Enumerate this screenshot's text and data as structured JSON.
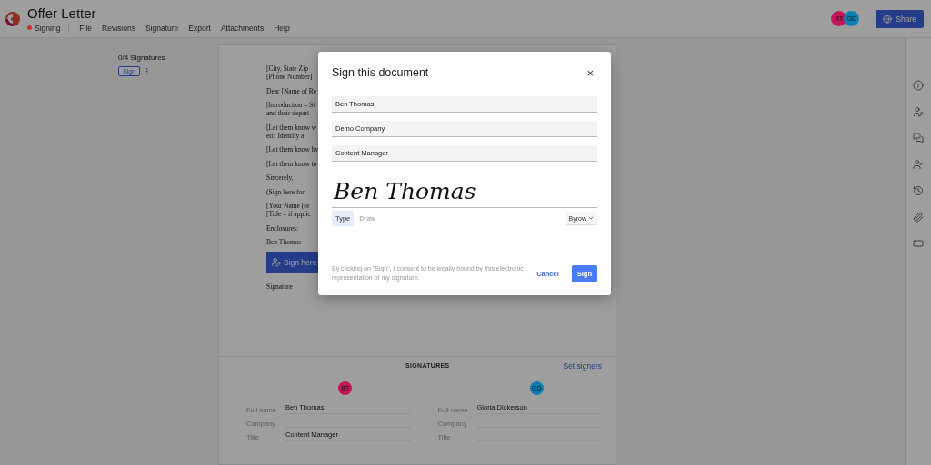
{
  "header": {
    "title": "Offer Letter",
    "status": {
      "label": "Signing",
      "color": "#c0392b"
    },
    "menu": [
      "File",
      "Revisions",
      "Signature",
      "Export",
      "Attachments",
      "Help"
    ],
    "avatars": [
      {
        "initials": "BT",
        "color": "#c2185b"
      },
      {
        "initials": "GD",
        "color": "#0a7fb0"
      }
    ],
    "share": "Share"
  },
  "signature_panel": {
    "count": "0/4 Signatures",
    "sign_button": "Sign"
  },
  "document": {
    "paragraphs": [
      [
        "[City, State Zip",
        "[Phone Number]"
      ],
      [
        "Dear [Name of Re"
      ],
      [
        "[Introduction – St",
        "and their depart"
      ],
      [
        "[Let them know w",
        "etc. Identify a"
      ],
      [
        "[Let them know by"
      ],
      [
        "[Let them know to"
      ],
      [
        "Sincerely,"
      ],
      [
        "(Sign here for"
      ],
      [
        "[Your Name (or",
        "[Title – if applic"
      ],
      [
        "Enclosures:"
      ],
      [
        "Ben Thomas"
      ]
    ],
    "sign_here": "Sign here",
    "closing": "Signature"
  },
  "signatures": {
    "heading": "SIGNATURES",
    "set_signers": "Set signers",
    "signers": [
      {
        "initials": "BT",
        "color": "#c2185b",
        "fields": [
          {
            "label": "Full name",
            "value": "Ben Thomas"
          },
          {
            "label": "Company"
          },
          {
            "label": "Title",
            "value": "Content Manager"
          }
        ]
      },
      {
        "initials": "GD",
        "color": "#0a7fb0",
        "fields": [
          {
            "label": "Full name",
            "value": "Gloria Dickerson"
          },
          {
            "label": "Company"
          },
          {
            "label": "Title"
          }
        ]
      }
    ]
  },
  "modal": {
    "title": "Sign this document",
    "close": "×",
    "fields": [
      "Ben Thomas",
      "Demo Company",
      "Content Manager"
    ],
    "signature": "Ben Thomas",
    "tabs": [
      {
        "label": "Type",
        "selected": true
      },
      {
        "label": "Draw",
        "selected": false
      }
    ],
    "font": "Byrow",
    "consent": "By clicking on \"Sign\", I consent to be legally bound by this electronic representation of my signature.",
    "cancel": "Cancel",
    "sign": "Sign"
  }
}
